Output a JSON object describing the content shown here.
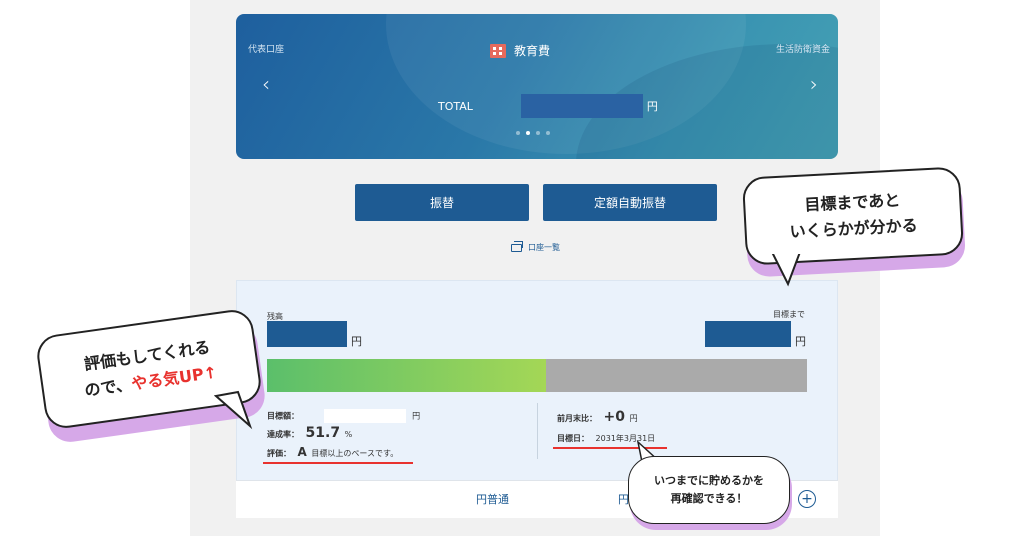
{
  "hero": {
    "left_account": "代表口座",
    "title": "教育費",
    "right_account": "生活防衛資金",
    "total_label": "TOTAL",
    "total_unit": "円",
    "page_count": 4,
    "active_page": 1
  },
  "actions": {
    "transfer": "振替",
    "auto_transfer": "定額自動振替",
    "account_list": "口座一覧"
  },
  "goal": {
    "balance_label": "残高",
    "remaining_label": "目標まで",
    "yen": "円",
    "progress_percent": 51.7,
    "target_amount_label": "目標額：",
    "target_yen": "円",
    "rate_label": "達成率：",
    "rate_value": "51.7",
    "rate_unit": "%",
    "eval_label": "評価：",
    "eval_grade": "A",
    "eval_text": "目標以上のペースです。",
    "mom_label": "前月末比：",
    "mom_value": "+0",
    "mom_unit": "円",
    "date_label": "目標日：",
    "date_value": "2031年3月31日"
  },
  "tabs": {
    "tab1": "円普通",
    "tab2": "円"
  },
  "callouts": {
    "c1_line1": "目標まであと",
    "c1_line2": "いくらかが分かる",
    "c2_line1": "評価もしてくれる",
    "c2_line2a": "ので、",
    "c2_line2b": "やる気UP↑",
    "c3_line1": "いつまでに貯めるかを",
    "c3_line2": "再確認できる！"
  },
  "colors": {
    "primary": "#1e5b93",
    "accent_red": "#e8322e",
    "progress_start": "#5bbf6b",
    "progress_end": "#a4d756",
    "callout_shadow": "#d6a8e8"
  }
}
